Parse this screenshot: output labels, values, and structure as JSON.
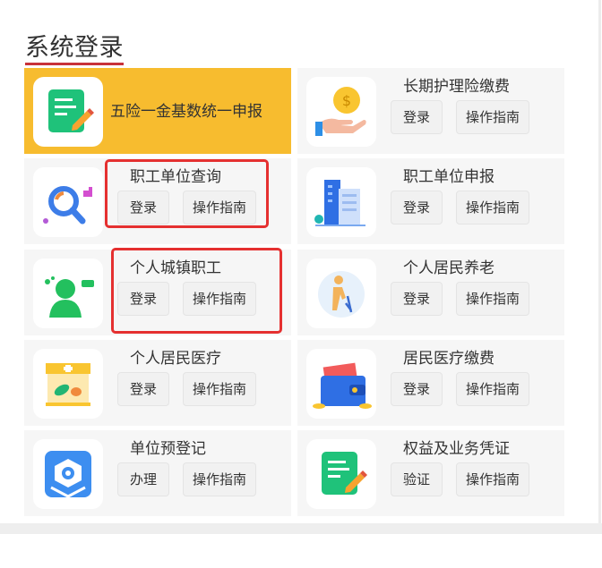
{
  "page": {
    "title": "系统登录"
  },
  "cards": [
    {
      "title": "五险一金基数统一申报",
      "icon": "form-edit-icon"
    },
    {
      "title": "长期护理险缴费",
      "icon": "coin-hand-icon",
      "btn1": "登录",
      "btn2": "操作指南"
    },
    {
      "title": "职工单位查询",
      "icon": "search-magnifier-icon",
      "btn1": "登录",
      "btn2": "操作指南"
    },
    {
      "title": "职工单位申报",
      "icon": "building-icon",
      "btn1": "登录",
      "btn2": "操作指南"
    },
    {
      "title": "个人城镇职工",
      "icon": "person-chat-icon",
      "btn1": "登录",
      "btn2": "操作指南"
    },
    {
      "title": "个人居民养老",
      "icon": "elderly-cane-icon",
      "btn1": "登录",
      "btn2": "操作指南"
    },
    {
      "title": "个人居民医疗",
      "icon": "pharmacy-icon",
      "btn1": "登录",
      "btn2": "操作指南"
    },
    {
      "title": "居民医疗缴费",
      "icon": "wallet-icon",
      "btn1": "登录",
      "btn2": "操作指南"
    },
    {
      "title": "单位预登记",
      "icon": "shield-gear-icon",
      "btn1": "办理",
      "btn2": "操作指南"
    },
    {
      "title": "权益及业务凭证",
      "icon": "form-edit-icon",
      "btn1": "验证",
      "btn2": "操作指南"
    }
  ],
  "colors": {
    "accent": "#f7bc2f",
    "highlight": "#e53030",
    "title_underline": "#c8323a"
  }
}
